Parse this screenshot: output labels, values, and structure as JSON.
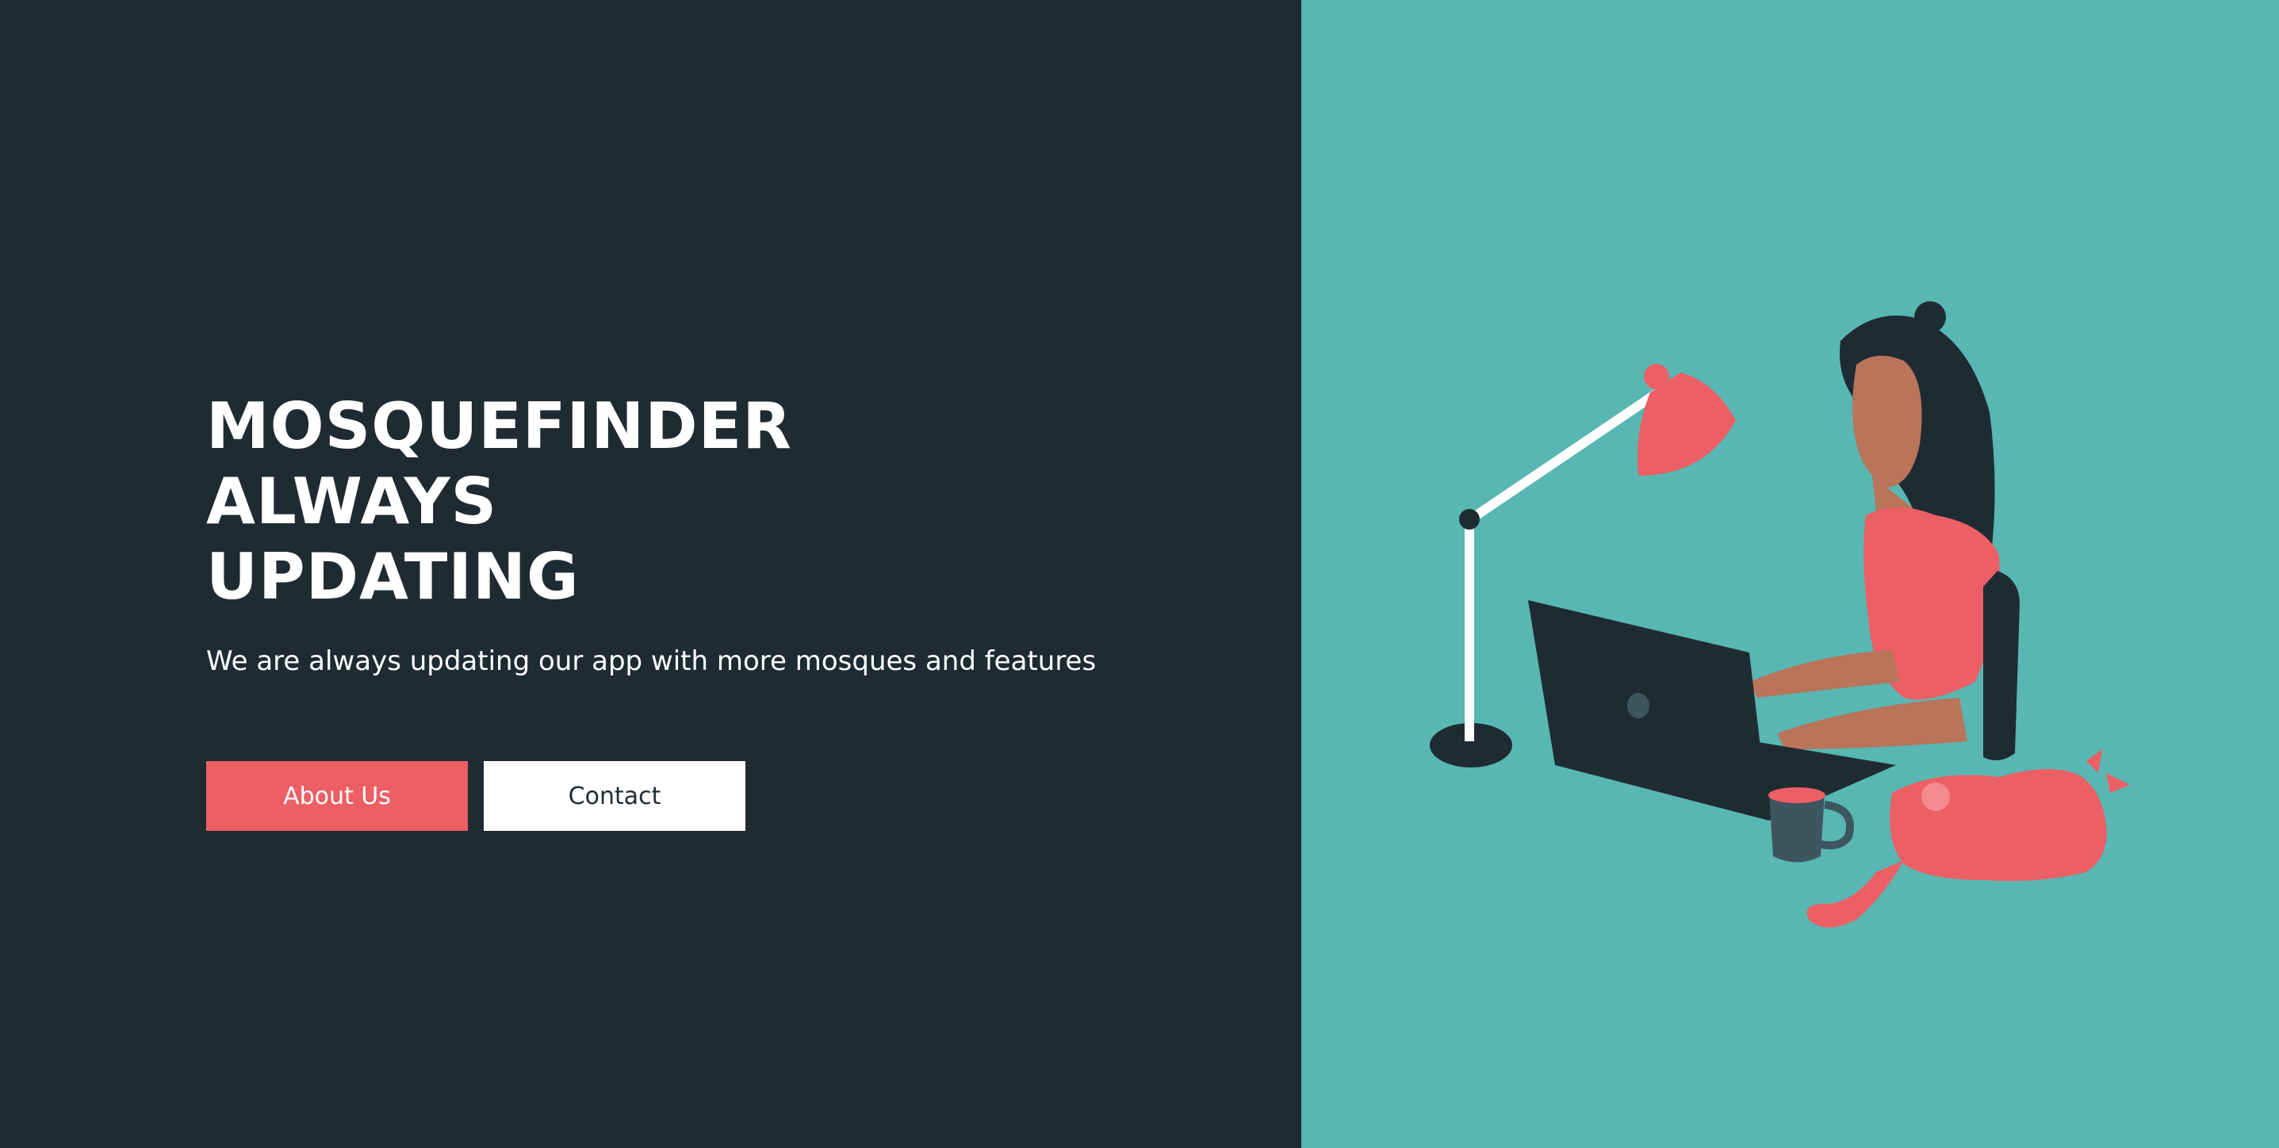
{
  "hero": {
    "title_lines": [
      "MOSQUEFINDER",
      "ALWAYS",
      "UPDATING"
    ],
    "subtitle": "We are always updating our app with more mosques and features"
  },
  "buttons": {
    "about_label": "About Us",
    "contact_label": "Contact"
  },
  "colors": {
    "left_background": "#1f2b33",
    "right_background": "#58b7b2",
    "accent": "#ec5f65",
    "text_light": "#ffffff"
  },
  "illustration": {
    "icon_name": "woman-working-on-laptop-illustration"
  }
}
